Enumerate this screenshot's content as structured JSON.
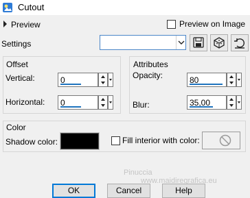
{
  "window": {
    "title": "Cutout"
  },
  "preview": {
    "label": "Preview",
    "on_image_label": "Preview on Image",
    "on_image_checked": false
  },
  "settings": {
    "label": "Settings",
    "value": ""
  },
  "offset": {
    "title": "Offset",
    "vertical": {
      "label": "Vertical:",
      "value": "0"
    },
    "horizontal": {
      "label": "Horizontal:",
      "value": "0"
    }
  },
  "attributes": {
    "title": "Attributes",
    "opacity": {
      "label": "Opacity:",
      "value": "80"
    },
    "blur": {
      "label": "Blur:",
      "value": "35,00"
    }
  },
  "color": {
    "title": "Color",
    "shadow_label": "Shadow color:",
    "shadow_color": "#000000",
    "fill_label": "Fill interior with color:",
    "fill_checked": false
  },
  "watermark": {
    "line1": "Pinuccia",
    "line2": "www.maidiregrafica.eu"
  },
  "buttons": {
    "ok": "OK",
    "cancel": "Cancel",
    "help": "Help"
  }
}
